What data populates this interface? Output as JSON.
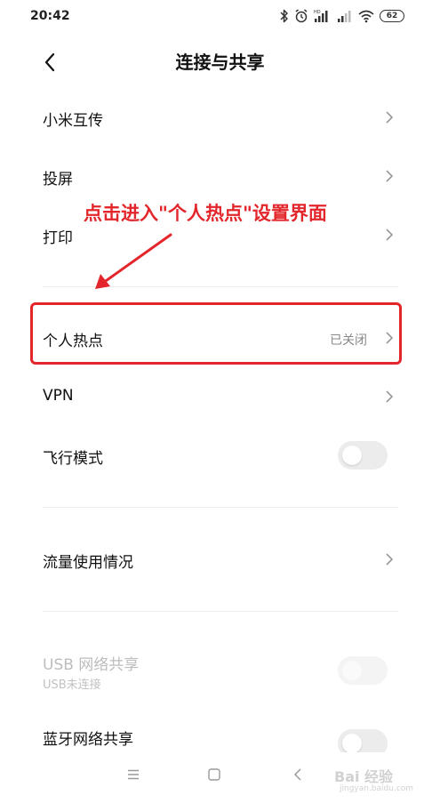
{
  "status_bar": {
    "time": "20:42",
    "battery": "62",
    "icons": [
      "bluetooth-icon",
      "alarm-icon",
      "signal-hd-icon",
      "signal-icon",
      "wifi-icon",
      "battery-icon"
    ]
  },
  "header": {
    "title": "连接与共享",
    "back_icon": "chevron-left-icon"
  },
  "settings": {
    "mi_share": "小米互传",
    "cast": "投屏",
    "print": "打印",
    "hotspot": {
      "label": "个人热点",
      "value": "已关闭"
    },
    "vpn": "VPN",
    "airplane": {
      "label": "飞行模式",
      "state": "off"
    },
    "data_usage": "流量使用情况",
    "usb_tethering": {
      "label": "USB 网络共享",
      "sub": "USB未连接",
      "state": "disabled"
    },
    "bt_tethering": {
      "label": "蓝牙网络共享",
      "state": "off"
    }
  },
  "annotation": {
    "text": "点击进入\"个人热点\"设置界面",
    "color": "#e3262b"
  },
  "nav_bar": {
    "icons": [
      "menu-icon",
      "home-icon",
      "back-icon"
    ]
  },
  "watermark": {
    "main": "Bai 经验",
    "sub": "jingyan.baidu.com"
  }
}
